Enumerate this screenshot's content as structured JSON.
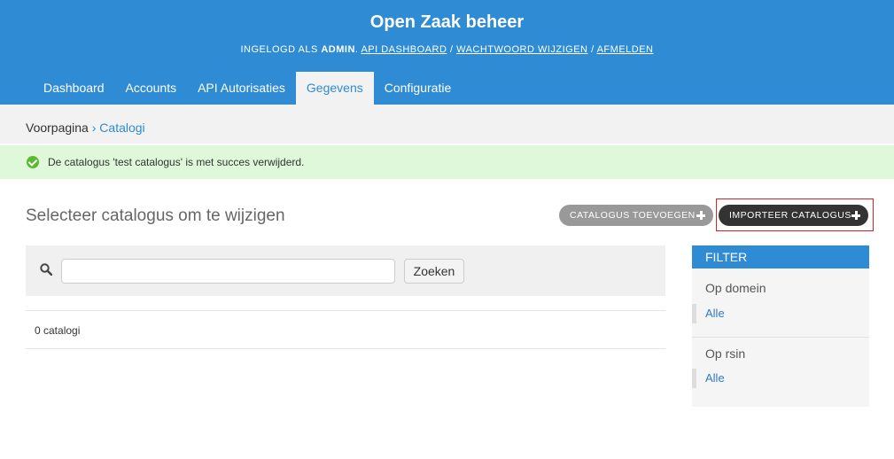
{
  "header": {
    "title": "Open Zaak beheer",
    "user_prefix": "INGELOGD ALS",
    "username": "ADMIN",
    "links": [
      "API DASHBOARD",
      "WACHTWOORD WIJZIGEN",
      "AFMELDEN"
    ],
    "separator": "/"
  },
  "nav": {
    "items": [
      "Dashboard",
      "Accounts",
      "API Autorisaties",
      "Gegevens",
      "Configuratie"
    ],
    "active": "Gegevens"
  },
  "breadcrumbs": {
    "home": "Voorpagina",
    "separator": "›",
    "current": "Catalogi"
  },
  "message": {
    "text": "De catalogus 'test catalogus' is met succes verwijderd.",
    "type": "success",
    "color": "#dff8d9"
  },
  "page": {
    "heading": "Selecteer catalogus om te wijzigen"
  },
  "object_tools": {
    "add_label": "CATALOGUS TOEVOEGEN",
    "import_label": "IMPORTEER CATALOGUS"
  },
  "search": {
    "value": "",
    "placeholder": "",
    "button_label": "Zoeken"
  },
  "results": {
    "count_text": "0 catalogi"
  },
  "filter": {
    "title": "FILTER",
    "groups": [
      {
        "heading": "Op domein",
        "option": "Alle"
      },
      {
        "heading": "Op rsin",
        "option": "Alle"
      }
    ]
  },
  "colors": {
    "primary": "#2e8bd4",
    "success_bg": "#dff8d9",
    "highlight": "#e02020"
  }
}
